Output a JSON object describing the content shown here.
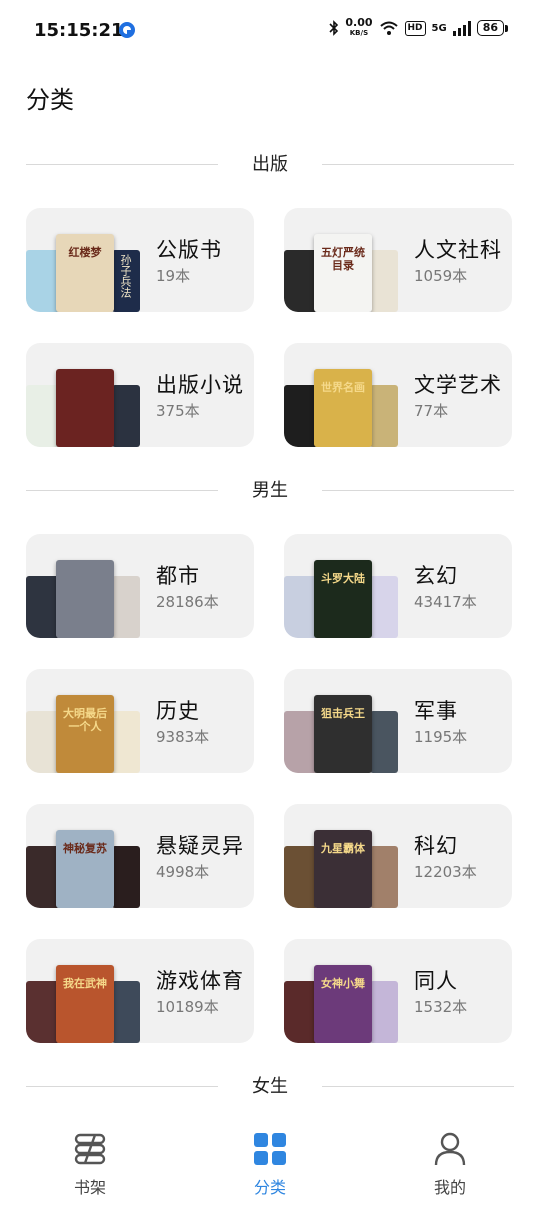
{
  "status_bar": {
    "time": "15:15:21",
    "net_speed": "0.00",
    "net_unit": "KB/S",
    "hd": "HD",
    "network": "5G",
    "battery": "86"
  },
  "page": {
    "title": "分类"
  },
  "sections": [
    {
      "label": "出版"
    },
    {
      "label": "男生"
    },
    {
      "label": "女生"
    }
  ],
  "categories": [
    {
      "title": "公版书",
      "count": "19本",
      "front_color": "#e7d7b8",
      "front_text": "红楼梦",
      "left_color": "#a9d3e6",
      "right_color": "#1e2c4a",
      "right_text": "孙子兵法"
    },
    {
      "title": "人文社科",
      "count": "1059本",
      "front_color": "#f4f4f2",
      "front_text": "五灯严统目录",
      "left_color": "#2a2a2a",
      "right_color": "#e9e3d5"
    },
    {
      "title": "出版小说",
      "count": "375本",
      "front_color": "#6b2321",
      "left_color": "#e8efe6",
      "right_color": "#2b3240"
    },
    {
      "title": "文学艺术",
      "count": "77本",
      "front_color": "#d9b24a",
      "front_text": "世界名画",
      "left_color": "#1e1e1e",
      "right_color": "#c9b378"
    },
    {
      "title": "都市",
      "count": "28186本",
      "front_color": "#7a7f8c",
      "left_color": "#2e3440",
      "right_color": "#d8d2cc"
    },
    {
      "title": "玄幻",
      "count": "43417本",
      "front_color": "#1c2a1c",
      "front_text": "斗罗大陆",
      "left_color": "#c8cfe0",
      "right_color": "#d7d4ea"
    },
    {
      "title": "历史",
      "count": "9383本",
      "front_color": "#c08a3a",
      "front_text": "大明最后一个人",
      "left_color": "#e8e3d6",
      "right_color": "#efe7d2"
    },
    {
      "title": "军事",
      "count": "1195本",
      "front_color": "#2f2f2f",
      "front_text": "狙击兵王",
      "left_color": "#b7a2a8",
      "right_color": "#4a5560"
    },
    {
      "title": "悬疑灵异",
      "count": "4998本",
      "front_color": "#9fb2c4",
      "front_text": "神秘复苏",
      "left_color": "#3a2a2a",
      "right_color": "#2a1e1e"
    },
    {
      "title": "科幻",
      "count": "12203本",
      "front_color": "#3b2f36",
      "front_text": "九星霸体",
      "left_color": "#6b5034",
      "right_color": "#a1806a"
    },
    {
      "title": "游戏体育",
      "count": "10189本",
      "front_color": "#b9552d",
      "front_text": "我在武神",
      "left_color": "#5a3030",
      "right_color": "#3e4a5a"
    },
    {
      "title": "同人",
      "count": "1532本",
      "front_color": "#6c3a7a",
      "front_text": "女神小舞",
      "left_color": "#5a2a2a",
      "right_color": "#c4b6d8"
    }
  ],
  "tabbar": {
    "items": [
      {
        "label": "书架",
        "icon": "bookshelf-icon"
      },
      {
        "label": "分类",
        "icon": "category-grid-icon"
      },
      {
        "label": "我的",
        "icon": "profile-icon"
      }
    ],
    "active_color": "#2f86e0"
  }
}
